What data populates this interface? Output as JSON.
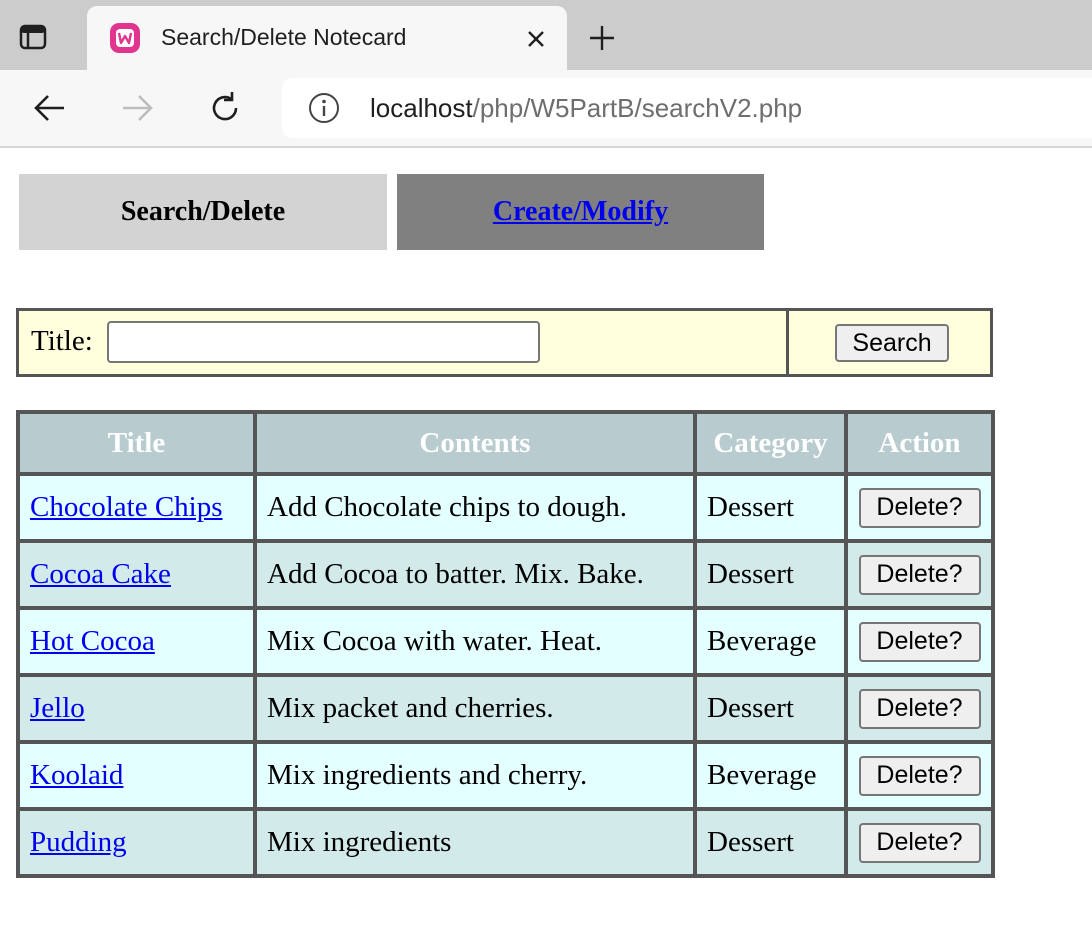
{
  "browser": {
    "tab_title": "Search/Delete Notecard",
    "address_host": "localhost",
    "address_path": "/php/W5PartB/searchV2.php"
  },
  "nav": {
    "search_delete": "Search/Delete",
    "create_modify": "Create/Modify"
  },
  "search": {
    "label": "Title:",
    "value": "",
    "button": "Search"
  },
  "table": {
    "headers": [
      "Title",
      "Contents",
      "Category",
      "Action"
    ],
    "rows": [
      {
        "title": "Chocolate Chips",
        "contents": "Add Chocolate chips to dough.",
        "category": "Dessert",
        "action": "Delete?"
      },
      {
        "title": "Cocoa Cake",
        "contents": "Add Cocoa to batter. Mix. Bake.",
        "category": "Dessert",
        "action": "Delete?"
      },
      {
        "title": "Hot Cocoa",
        "contents": "Mix Cocoa with water. Heat.",
        "category": "Beverage",
        "action": "Delete?"
      },
      {
        "title": "Jello",
        "contents": "Mix packet and cherries.",
        "category": "Dessert",
        "action": "Delete?"
      },
      {
        "title": "Koolaid",
        "contents": "Mix ingredients and cherry.",
        "category": "Beverage",
        "action": "Delete?"
      },
      {
        "title": "Pudding",
        "contents": "Mix ingredients",
        "category": "Dessert",
        "action": "Delete?"
      }
    ]
  },
  "colors": {
    "header_bg": "#b8cbcf",
    "row_odd": "#e4ffff",
    "row_even": "#d3eaea",
    "search_bg": "#ffffdd",
    "link": "#0000ee",
    "favicon": "#e0368f"
  },
  "icons": {
    "tabs": "tab-actions-icon",
    "favicon": "wamp-favicon-icon",
    "close": "close-icon",
    "new_tab": "plus-icon",
    "back": "back-arrow-icon",
    "forward": "forward-arrow-icon",
    "reload": "reload-icon",
    "info": "info-icon"
  }
}
